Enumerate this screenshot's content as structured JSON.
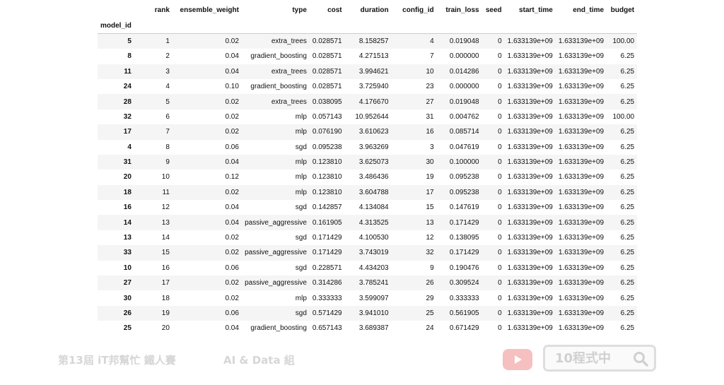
{
  "table": {
    "columns": [
      "rank",
      "ensemble_weight",
      "type",
      "cost",
      "duration",
      "config_id",
      "train_loss",
      "seed",
      "start_time",
      "end_time",
      "budget"
    ],
    "index_name": "model_id",
    "rows": [
      {
        "model_id": "5",
        "cells": [
          "1",
          "0.02",
          "extra_trees",
          "0.028571",
          "8.158257",
          "4",
          "0.019048",
          "0",
          "1.633139e+09",
          "1.633139e+09",
          "100.00"
        ]
      },
      {
        "model_id": "8",
        "cells": [
          "2",
          "0.04",
          "gradient_boosting",
          "0.028571",
          "4.271513",
          "7",
          "0.000000",
          "0",
          "1.633139e+09",
          "1.633139e+09",
          "6.25"
        ]
      },
      {
        "model_id": "11",
        "cells": [
          "3",
          "0.04",
          "extra_trees",
          "0.028571",
          "3.994621",
          "10",
          "0.014286",
          "0",
          "1.633139e+09",
          "1.633139e+09",
          "6.25"
        ]
      },
      {
        "model_id": "24",
        "cells": [
          "4",
          "0.10",
          "gradient_boosting",
          "0.028571",
          "3.725940",
          "23",
          "0.000000",
          "0",
          "1.633139e+09",
          "1.633139e+09",
          "6.25"
        ]
      },
      {
        "model_id": "28",
        "cells": [
          "5",
          "0.02",
          "extra_trees",
          "0.038095",
          "4.176670",
          "27",
          "0.019048",
          "0",
          "1.633139e+09",
          "1.633139e+09",
          "6.25"
        ]
      },
      {
        "model_id": "32",
        "cells": [
          "6",
          "0.02",
          "mlp",
          "0.057143",
          "10.952644",
          "31",
          "0.004762",
          "0",
          "1.633139e+09",
          "1.633139e+09",
          "100.00"
        ]
      },
      {
        "model_id": "17",
        "cells": [
          "7",
          "0.02",
          "mlp",
          "0.076190",
          "3.610623",
          "16",
          "0.085714",
          "0",
          "1.633139e+09",
          "1.633139e+09",
          "6.25"
        ]
      },
      {
        "model_id": "4",
        "cells": [
          "8",
          "0.06",
          "sgd",
          "0.095238",
          "3.963269",
          "3",
          "0.047619",
          "0",
          "1.633139e+09",
          "1.633139e+09",
          "6.25"
        ]
      },
      {
        "model_id": "31",
        "cells": [
          "9",
          "0.04",
          "mlp",
          "0.123810",
          "3.625073",
          "30",
          "0.100000",
          "0",
          "1.633139e+09",
          "1.633139e+09",
          "6.25"
        ]
      },
      {
        "model_id": "20",
        "cells": [
          "10",
          "0.12",
          "mlp",
          "0.123810",
          "3.486436",
          "19",
          "0.095238",
          "0",
          "1.633139e+09",
          "1.633139e+09",
          "6.25"
        ]
      },
      {
        "model_id": "18",
        "cells": [
          "11",
          "0.02",
          "mlp",
          "0.123810",
          "3.604788",
          "17",
          "0.095238",
          "0",
          "1.633139e+09",
          "1.633139e+09",
          "6.25"
        ]
      },
      {
        "model_id": "16",
        "cells": [
          "12",
          "0.04",
          "sgd",
          "0.142857",
          "4.134084",
          "15",
          "0.147619",
          "0",
          "1.633139e+09",
          "1.633139e+09",
          "6.25"
        ]
      },
      {
        "model_id": "14",
        "cells": [
          "13",
          "0.04",
          "passive_aggressive",
          "0.161905",
          "4.313525",
          "13",
          "0.171429",
          "0",
          "1.633139e+09",
          "1.633139e+09",
          "6.25"
        ]
      },
      {
        "model_id": "13",
        "cells": [
          "14",
          "0.02",
          "sgd",
          "0.171429",
          "4.100530",
          "12",
          "0.138095",
          "0",
          "1.633139e+09",
          "1.633139e+09",
          "6.25"
        ]
      },
      {
        "model_id": "33",
        "cells": [
          "15",
          "0.02",
          "passive_aggressive",
          "0.171429",
          "3.743019",
          "32",
          "0.171429",
          "0",
          "1.633139e+09",
          "1.633139e+09",
          "6.25"
        ]
      },
      {
        "model_id": "10",
        "cells": [
          "16",
          "0.06",
          "sgd",
          "0.228571",
          "4.434203",
          "9",
          "0.190476",
          "0",
          "1.633139e+09",
          "1.633139e+09",
          "6.25"
        ]
      },
      {
        "model_id": "27",
        "cells": [
          "17",
          "0.02",
          "passive_aggressive",
          "0.314286",
          "3.785241",
          "26",
          "0.309524",
          "0",
          "1.633139e+09",
          "1.633139e+09",
          "6.25"
        ]
      },
      {
        "model_id": "30",
        "cells": [
          "18",
          "0.02",
          "mlp",
          "0.333333",
          "3.599097",
          "29",
          "0.333333",
          "0",
          "1.633139e+09",
          "1.633139e+09",
          "6.25"
        ]
      },
      {
        "model_id": "26",
        "cells": [
          "19",
          "0.06",
          "sgd",
          "0.571429",
          "3.941010",
          "25",
          "0.561905",
          "0",
          "1.633139e+09",
          "1.633139e+09",
          "6.25"
        ]
      },
      {
        "model_id": "25",
        "cells": [
          "20",
          "0.04",
          "gradient_boosting",
          "0.657143",
          "3.689387",
          "24",
          "0.671429",
          "0",
          "1.633139e+09",
          "1.633139e+09",
          "6.25"
        ]
      }
    ]
  },
  "footer": {
    "event_label": "第13屆 iT邦幫忙 鐵人賽",
    "group_label": "AI & Data 組",
    "channel_label": "10程式中",
    "youtube_icon": "youtube-play-icon",
    "search_icon": "magnifier-icon",
    "watermark_color": "#d6d6d6",
    "youtube_color": "#f6c0c0"
  }
}
